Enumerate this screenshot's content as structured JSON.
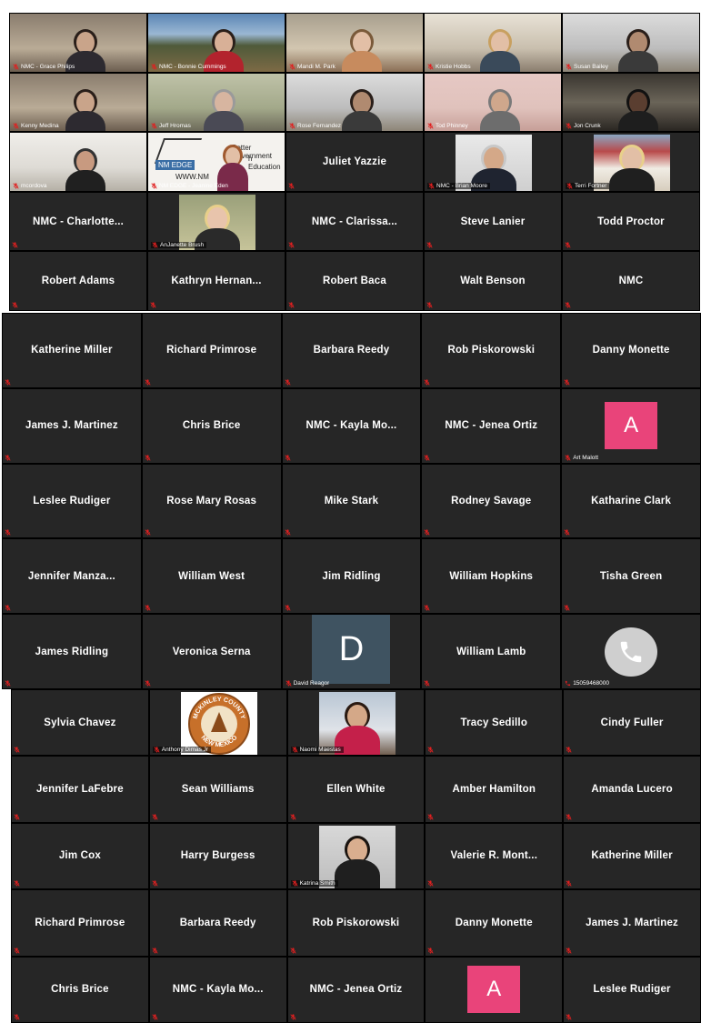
{
  "colors": {
    "tile_bg": "#262626",
    "grid_bg": "#000000",
    "mute_icon": "#e02020",
    "avatar_pink": "#e9447a",
    "avatar_slate": "#3f5361"
  },
  "section1": [
    {
      "type": "video",
      "label": "NMC - Grace Philips",
      "scene": "office"
    },
    {
      "type": "video",
      "label": "NMC - Bonnie Cummings",
      "scene": "mountains"
    },
    {
      "type": "video",
      "label": "Mandi M. Park",
      "scene": "room"
    },
    {
      "type": "video",
      "label": "Kristie Hobbs",
      "scene": "window"
    },
    {
      "type": "video",
      "label": "Susan Bailey",
      "scene": "ceiling"
    },
    {
      "type": "video",
      "label": "Kenny Medina",
      "scene": "office"
    },
    {
      "type": "video",
      "label": "Jeff Hromas",
      "scene": "green"
    },
    {
      "type": "video",
      "label": "Rose Fernandez",
      "scene": "ceiling"
    },
    {
      "type": "video",
      "label": "Tod Phinney",
      "scene": "pink"
    },
    {
      "type": "video",
      "label": "Jon Crunk",
      "scene": "dark"
    },
    {
      "type": "video",
      "label": "mcordova",
      "scene": "white"
    },
    {
      "type": "video",
      "label": "NM EDGE - Jeanine Eden",
      "scene": "edge",
      "logo_text": "NM EDGE",
      "overlay_text": "Better Government",
      "overlay_text2": "h Education",
      "url_text": "WWW.NM"
    },
    {
      "type": "name",
      "name": "Juliet Yazzie"
    },
    {
      "type": "photo",
      "label": "NMC - Brian Moore",
      "scene": "portrait"
    },
    {
      "type": "photo",
      "label": "Terri Fortner",
      "scene": "flag"
    },
    {
      "type": "name",
      "name": "NMC - Charlotte..."
    },
    {
      "type": "photo",
      "label": "AnJanette Brush",
      "scene": "blonde"
    },
    {
      "type": "name",
      "name": "NMC - Clarissa..."
    },
    {
      "type": "name",
      "name": "Steve Lanier"
    },
    {
      "type": "name",
      "name": "Todd Proctor"
    },
    {
      "type": "name",
      "name": "Robert Adams"
    },
    {
      "type": "name",
      "name": "Kathryn Hernan..."
    },
    {
      "type": "name",
      "name": "Robert Baca"
    },
    {
      "type": "name",
      "name": "Walt Benson"
    },
    {
      "type": "name",
      "name": "NMC"
    }
  ],
  "section2": [
    {
      "type": "name",
      "name": "Katherine Miller"
    },
    {
      "type": "name",
      "name": "Richard Primrose"
    },
    {
      "type": "name",
      "name": "Barbara Reedy"
    },
    {
      "type": "name",
      "name": "Rob Piskorowski"
    },
    {
      "type": "name",
      "name": "Danny Monette"
    },
    {
      "type": "name",
      "name": "James J. Martinez"
    },
    {
      "type": "name",
      "name": "Chris Brice"
    },
    {
      "type": "name",
      "name": "NMC - Kayla Mo..."
    },
    {
      "type": "name",
      "name": "NMC - Jenea Ortiz"
    },
    {
      "type": "letter",
      "letter": "A",
      "label": "Art Malott"
    },
    {
      "type": "name",
      "name": "Leslee Rudiger"
    },
    {
      "type": "name",
      "name": "Rose Mary Rosas"
    },
    {
      "type": "name",
      "name": "Mike Stark"
    },
    {
      "type": "name",
      "name": "Rodney Savage"
    },
    {
      "type": "name",
      "name": "Katharine Clark"
    },
    {
      "type": "name",
      "name": "Jennifer Manza..."
    },
    {
      "type": "name",
      "name": "William West"
    },
    {
      "type": "name",
      "name": "Jim Ridling"
    },
    {
      "type": "name",
      "name": "William Hopkins"
    },
    {
      "type": "name",
      "name": "Tisha Green"
    },
    {
      "type": "name",
      "name": "James Ridling"
    },
    {
      "type": "name",
      "name": "Veronica Serna"
    },
    {
      "type": "letterD",
      "letter": "D",
      "label": "David Reagor"
    },
    {
      "type": "name",
      "name": "William Lamb"
    },
    {
      "type": "phone",
      "label": "15059468000"
    }
  ],
  "section3": [
    {
      "type": "name",
      "name": "Sylvia Chavez"
    },
    {
      "type": "seal",
      "label": "Anthony Dimas Jr",
      "seal_top": "MCKINLEY COUNTY",
      "seal_bottom": "NEW MEXICO"
    },
    {
      "type": "photo",
      "label": "Naomi Maestas",
      "scene": "desk"
    },
    {
      "type": "name",
      "name": "Tracy Sedillo"
    },
    {
      "type": "name",
      "name": "Cindy Fuller"
    },
    {
      "type": "name",
      "name": "Jennifer LaFebre"
    },
    {
      "type": "name",
      "name": "Sean Williams"
    },
    {
      "type": "name",
      "name": "Ellen White"
    },
    {
      "type": "name",
      "name": "Amber Hamilton"
    },
    {
      "type": "name",
      "name": "Amanda Lucero"
    },
    {
      "type": "name",
      "name": "Jim Cox"
    },
    {
      "type": "name",
      "name": "Harry Burgess"
    },
    {
      "type": "photo",
      "label": "Katrina Smith",
      "scene": "headshot"
    },
    {
      "type": "name",
      "name": "Valerie R. Mont..."
    },
    {
      "type": "name",
      "name": "Katherine Miller"
    },
    {
      "type": "name",
      "name": "Richard Primrose"
    },
    {
      "type": "name",
      "name": "Barbara Reedy"
    },
    {
      "type": "name",
      "name": "Rob Piskorowski"
    },
    {
      "type": "name",
      "name": "Danny Monette"
    },
    {
      "type": "name",
      "name": "James J. Martinez"
    },
    {
      "type": "name",
      "name": "Chris Brice"
    },
    {
      "type": "name",
      "name": "NMC - Kayla Mo..."
    },
    {
      "type": "name",
      "name": "NMC - Jenea Ortiz"
    },
    {
      "type": "letter",
      "letter": "A",
      "label": ""
    },
    {
      "type": "name",
      "name": "Leslee Rudiger"
    }
  ]
}
